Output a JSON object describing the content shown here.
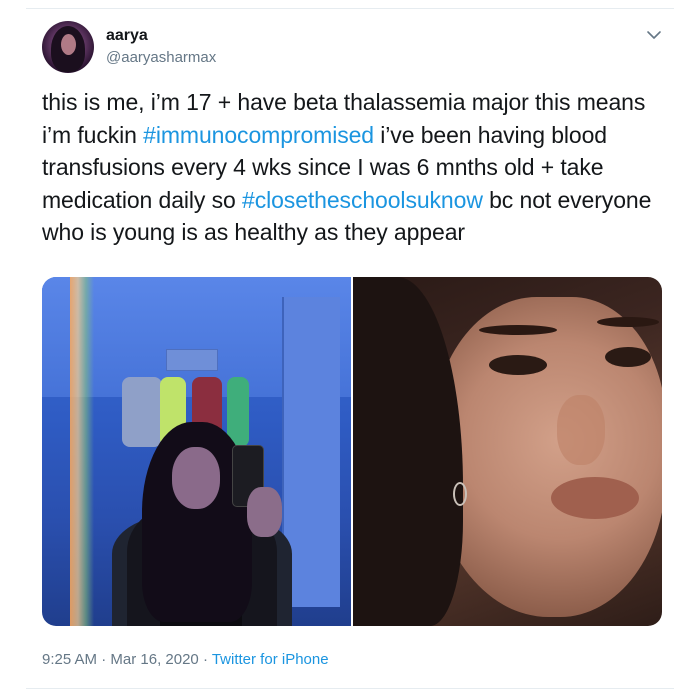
{
  "user": {
    "display_name": "aarya",
    "handle": "@aaryasharmax"
  },
  "tweet": {
    "segments": [
      {
        "text": "this is me, i’m 17 + have beta thalassemia major this means i’m fuckin ",
        "type": "text"
      },
      {
        "text": "#immunocompromised",
        "type": "hashtag"
      },
      {
        "text": " i’ve been having blood transfusions every 4 wks since I was 6 mnths old + take medication daily so ",
        "type": "text"
      },
      {
        "text": "#closetheschoolsuknow",
        "type": "hashtag"
      },
      {
        "text": " bc not everyone who is young is as healthy as they appear",
        "type": "text"
      }
    ]
  },
  "meta": {
    "time": "9:25 AM",
    "separator": " · ",
    "date": "Mar 16, 2020",
    "separator2": " · ",
    "source": "Twitter for iPhone"
  },
  "icons": {
    "caret": "chevron-down-icon"
  },
  "colors": {
    "link": "#1b95e0",
    "text": "#14171a",
    "muted": "#657786"
  }
}
